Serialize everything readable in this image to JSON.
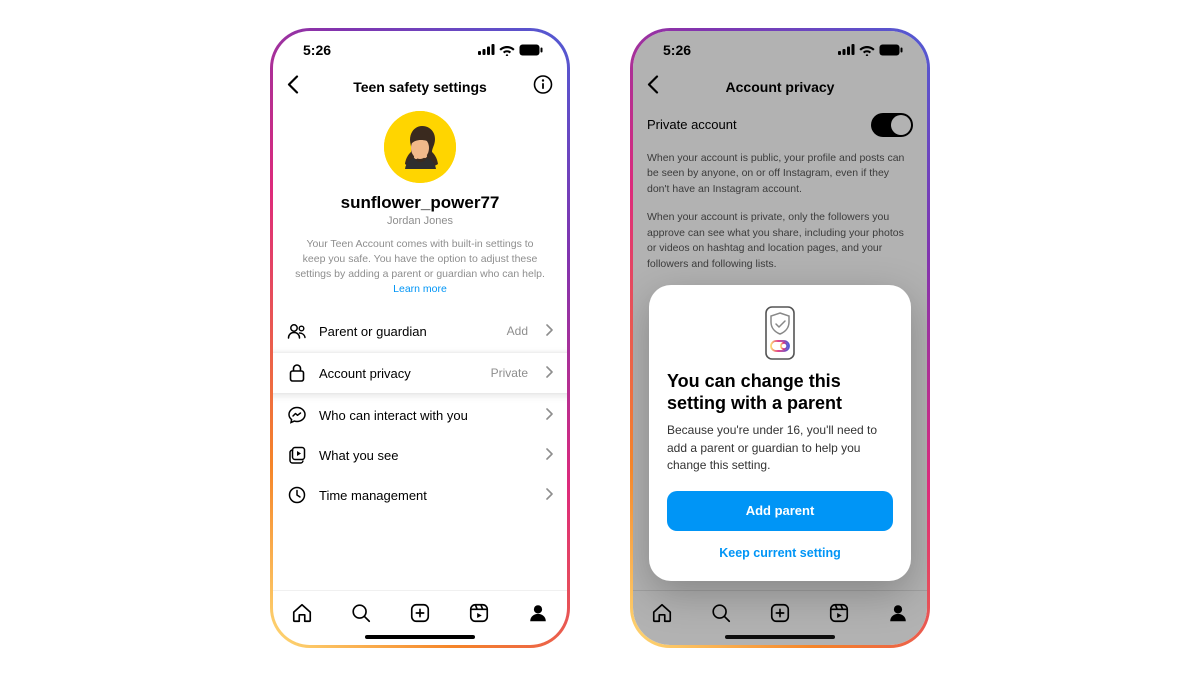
{
  "statusbar": {
    "time": "5:26"
  },
  "phone1": {
    "header_title": "Teen safety settings",
    "username": "sunflower_power77",
    "fullname": "Jordan Jones",
    "description": "Your Teen Account comes with built-in settings to keep you safe. You have the option to adjust these settings by adding a parent or guardian who can help.",
    "learn_more": "Learn more",
    "rows": {
      "parent": {
        "label": "Parent or guardian",
        "value": "Add"
      },
      "privacy": {
        "label": "Account privacy",
        "value": "Private"
      },
      "interact": {
        "label": "Who can interact with you"
      },
      "see": {
        "label": "What you see"
      },
      "time": {
        "label": "Time management"
      }
    }
  },
  "phone2": {
    "header_title": "Account privacy",
    "private_label": "Private account",
    "desc1": "When your account is public, your profile and posts can be seen by anyone, on or off Instagram, even if they don't have an Instagram account.",
    "desc2": "When your account is private, only the followers you approve can see what you share, including your photos or videos on hashtag and location pages, and your followers and following lists.",
    "card": {
      "title": "You can change this setting with a parent",
      "desc": "Because you're under 16, you'll need to add a parent or guardian to help you change this setting.",
      "primary": "Add parent",
      "secondary": "Keep current setting"
    }
  }
}
